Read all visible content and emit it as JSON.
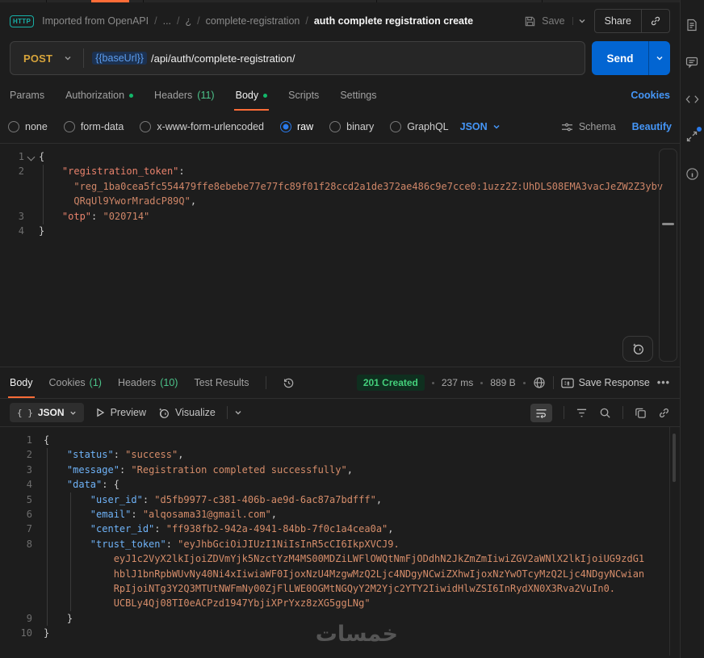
{
  "topbar": {
    "http_badge": "HTTP",
    "breadcrumb_parts": [
      "Imported from OpenAPI",
      "...",
      "¿",
      "complete-registration"
    ],
    "breadcrumb_current": "auth complete registration create",
    "separator": "/",
    "save_label": "Save",
    "share_label": "Share"
  },
  "request": {
    "method": "POST",
    "url_variable": "{{baseUrl}}",
    "url_path": "/api/auth/complete-registration/",
    "send_label": "Send",
    "tabs": [
      {
        "label": "Params"
      },
      {
        "label": "Authorization",
        "dot": true
      },
      {
        "label": "Headers",
        "count": "(11)"
      },
      {
        "label": "Body",
        "dot": true,
        "active": true
      },
      {
        "label": "Scripts"
      },
      {
        "label": "Settings"
      }
    ],
    "cookies_link": "Cookies",
    "body_modes": [
      "none",
      "form-data",
      "x-www-form-urlencoded",
      "raw",
      "binary",
      "GraphQL"
    ],
    "selected_mode": "raw",
    "language": "JSON",
    "schema_label": "Schema",
    "beautify_label": "Beautify",
    "editor": {
      "lines": [
        {
          "num": "1",
          "fold": true,
          "tokens": [
            {
              "c": "pun",
              "t": "{"
            }
          ]
        },
        {
          "num": "2",
          "tokens": [
            {
              "c": "ws",
              "t": "    "
            },
            {
              "c": "rkey",
              "t": "\"registration_token\""
            },
            {
              "c": "pun",
              "t": ":"
            }
          ]
        },
        {
          "num": "",
          "tokens": [
            {
              "c": "ws",
              "t": "      "
            },
            {
              "c": "rstr",
              "t": "\"reg_1ba0cea5fc554479ffe8ebebe77e77fc89f01f28ccd2a1de372ae486c9e7cce0:1uzz2Z:UhDLS08EMA3vacJeZW2Z3ybv"
            }
          ]
        },
        {
          "num": "",
          "tokens": [
            {
              "c": "ws",
              "t": "      "
            },
            {
              "c": "rstr",
              "t": "QRqUl9YworMradcP89Q\""
            },
            {
              "c": "pun",
              "t": ","
            }
          ]
        },
        {
          "num": "3",
          "tokens": [
            {
              "c": "ws",
              "t": "    "
            },
            {
              "c": "rkey",
              "t": "\"otp\""
            },
            {
              "c": "pun",
              "t": ": "
            },
            {
              "c": "rstr",
              "t": "\"020714\""
            }
          ]
        },
        {
          "num": "4",
          "tokens": [
            {
              "c": "pun",
              "t": "}"
            }
          ]
        }
      ]
    }
  },
  "response": {
    "tabs": [
      {
        "label": "Body",
        "active": true
      },
      {
        "label": "Cookies",
        "count": "(1)"
      },
      {
        "label": "Headers",
        "count": "(10)"
      },
      {
        "label": "Test Results"
      }
    ],
    "status": "201 Created",
    "time": "237 ms",
    "size": "889 B",
    "save_response_label": "Save Response",
    "format_braces": "{ }",
    "format": "JSON",
    "preview_label": "Preview",
    "visualize_label": "Visualize",
    "editor": {
      "lines": [
        {
          "num": "1",
          "tokens": [
            {
              "c": "pun",
              "t": "{"
            }
          ]
        },
        {
          "num": "2",
          "tokens": [
            {
              "c": "ws",
              "t": "    "
            },
            {
              "c": "key",
              "t": "\"status\""
            },
            {
              "c": "pun",
              "t": ": "
            },
            {
              "c": "str",
              "t": "\"success\""
            },
            {
              "c": "pun",
              "t": ","
            }
          ]
        },
        {
          "num": "3",
          "tokens": [
            {
              "c": "ws",
              "t": "    "
            },
            {
              "c": "key",
              "t": "\"message\""
            },
            {
              "c": "pun",
              "t": ": "
            },
            {
              "c": "str",
              "t": "\"Registration completed successfully\""
            },
            {
              "c": "pun",
              "t": ","
            }
          ]
        },
        {
          "num": "4",
          "tokens": [
            {
              "c": "ws",
              "t": "    "
            },
            {
              "c": "key",
              "t": "\"data\""
            },
            {
              "c": "pun",
              "t": ": {"
            }
          ]
        },
        {
          "num": "5",
          "tokens": [
            {
              "c": "ws",
              "t": "        "
            },
            {
              "c": "key",
              "t": "\"user_id\""
            },
            {
              "c": "pun",
              "t": ": "
            },
            {
              "c": "str",
              "t": "\"d5fb9977-c381-406b-ae9d-6ac87a7bdfff\""
            },
            {
              "c": "pun",
              "t": ","
            }
          ]
        },
        {
          "num": "6",
          "tokens": [
            {
              "c": "ws",
              "t": "        "
            },
            {
              "c": "key",
              "t": "\"email\""
            },
            {
              "c": "pun",
              "t": ": "
            },
            {
              "c": "str",
              "t": "\"alqosama31@gmail.com\""
            },
            {
              "c": "pun",
              "t": ","
            }
          ]
        },
        {
          "num": "7",
          "tokens": [
            {
              "c": "ws",
              "t": "        "
            },
            {
              "c": "key",
              "t": "\"center_id\""
            },
            {
              "c": "pun",
              "t": ": "
            },
            {
              "c": "str",
              "t": "\"ff938fb2-942a-4941-84bb-7f0c1a4cea0a\""
            },
            {
              "c": "pun",
              "t": ","
            }
          ]
        },
        {
          "num": "8",
          "tokens": [
            {
              "c": "ws",
              "t": "        "
            },
            {
              "c": "key",
              "t": "\"trust_token\""
            },
            {
              "c": "pun",
              "t": ": "
            },
            {
              "c": "str",
              "t": "\"eyJhbGciOiJIUzI1NiIsInR5cCI6IkpXVCJ9."
            }
          ]
        },
        {
          "num": "",
          "tokens": [
            {
              "c": "ws",
              "t": "            "
            },
            {
              "c": "str",
              "t": "eyJ1c2VyX2lkIjoiZDVmYjk5NzctYzM4MS00MDZiLWFlOWQtNmFjODdhN2JkZmZmIiwiZGV2aWNlX2lkIjoiUG9zdG1"
            }
          ]
        },
        {
          "num": "",
          "tokens": [
            {
              "c": "ws",
              "t": "            "
            },
            {
              "c": "str",
              "t": "hblJ1bnRpbWUvNy40Ni4xIiwiaWF0IjoxNzU4MzgwMzQ2Ljc4NDgyNCwiZXhwIjoxNzYwOTcyMzQ2Ljc4NDgyNCwian"
            }
          ]
        },
        {
          "num": "",
          "tokens": [
            {
              "c": "ws",
              "t": "            "
            },
            {
              "c": "str",
              "t": "RpIjoiNTg3Y2Q3MTUtNWFmNy00ZjFlLWE0OGMtNGQyY2M2Yjc2YTY2IiwidHlwZSI6InRydXN0X3Rva2VuIn0."
            }
          ]
        },
        {
          "num": "",
          "tokens": [
            {
              "c": "ws",
              "t": "            "
            },
            {
              "c": "str",
              "t": "UCBLy4Qj08TI0eACPzd1947YbjiXPrYxz8zXG5ggLNg\""
            }
          ]
        },
        {
          "num": "9",
          "tokens": [
            {
              "c": "ws",
              "t": "    "
            },
            {
              "c": "pun",
              "t": "}"
            }
          ]
        },
        {
          "num": "10",
          "tokens": [
            {
              "c": "pun",
              "t": "}"
            }
          ]
        }
      ]
    }
  },
  "watermark": "خمسات",
  "colors": {
    "accent_orange": "#ff6c37",
    "method_post_yellow": "#d7a43b",
    "send_blue": "#0265d2",
    "success_green": "#44d07b",
    "link_blue": "#4596f7",
    "variable_blue": "#5c9ded",
    "json_key_blue": "#6fb3f8",
    "json_string_orange": "#d68d6a"
  }
}
